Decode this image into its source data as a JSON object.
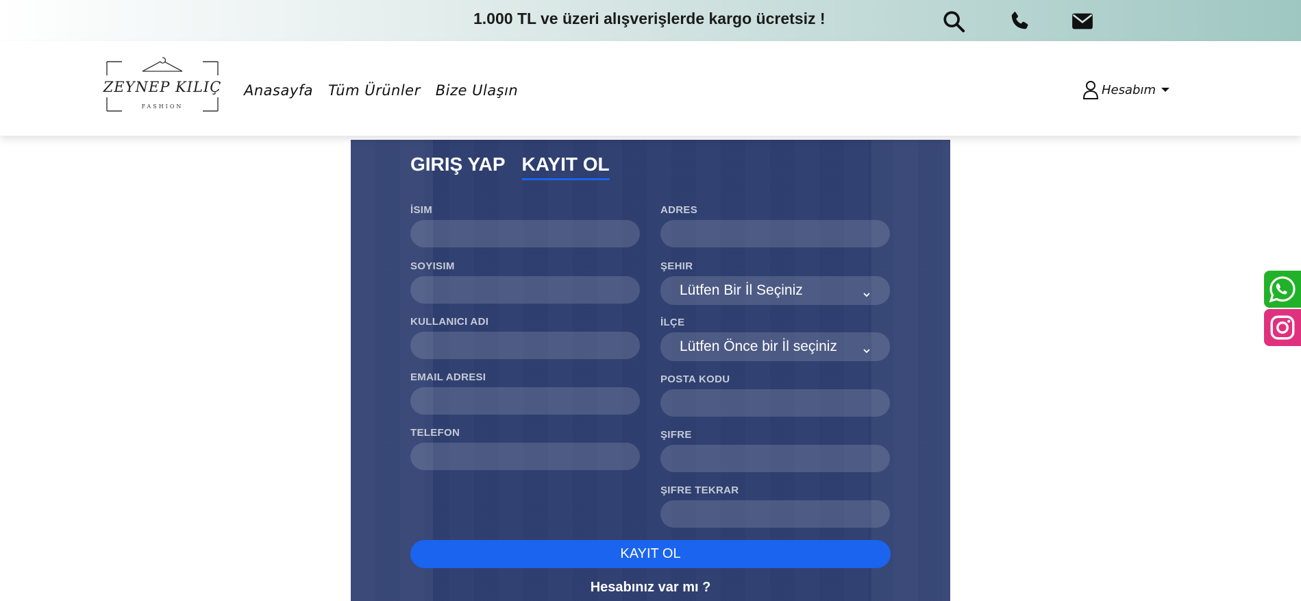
{
  "topbar": {
    "promo": "1.000 TL ve üzeri alışverişlerde kargo ücretsiz !",
    "icons": [
      "search-icon",
      "phone-icon",
      "mail-icon"
    ]
  },
  "header": {
    "logo": {
      "text": "ZEYNEP KILIÇ",
      "subtext": "FASHION"
    },
    "nav": [
      "Anasayfa",
      "Tüm Ürünler",
      "Bize Ulaşın"
    ],
    "account_label": "Hesabım"
  },
  "form": {
    "tabs": {
      "login": "GIRIŞ YAP",
      "register": "KAYIT OL"
    },
    "active_tab": "register",
    "left_fields": {
      "name": "İSIM",
      "surname": "SOYISIM",
      "username": "KULLANICI ADI",
      "email": "EMAIL ADRESI",
      "phone": "TELEFON"
    },
    "right_fields": {
      "address": "ADRES",
      "city": "ŞEHIR",
      "city_selected": "Lütfen Bir İl Seçiniz",
      "district": "İLÇE",
      "district_selected": "Lütfen Önce bir İl seçiniz",
      "postal": "POSTA KODU",
      "password": "ŞIFRE",
      "password_repeat": "ŞIFRE TEKRAR"
    },
    "submit_label": "KAYIT OL",
    "have_account": "Hesabınız var mı ?"
  },
  "colors": {
    "accent": "#1a64ef",
    "panel": "#2d3e70",
    "whatsapp": "#22b229",
    "instagram": "#e0317e"
  }
}
